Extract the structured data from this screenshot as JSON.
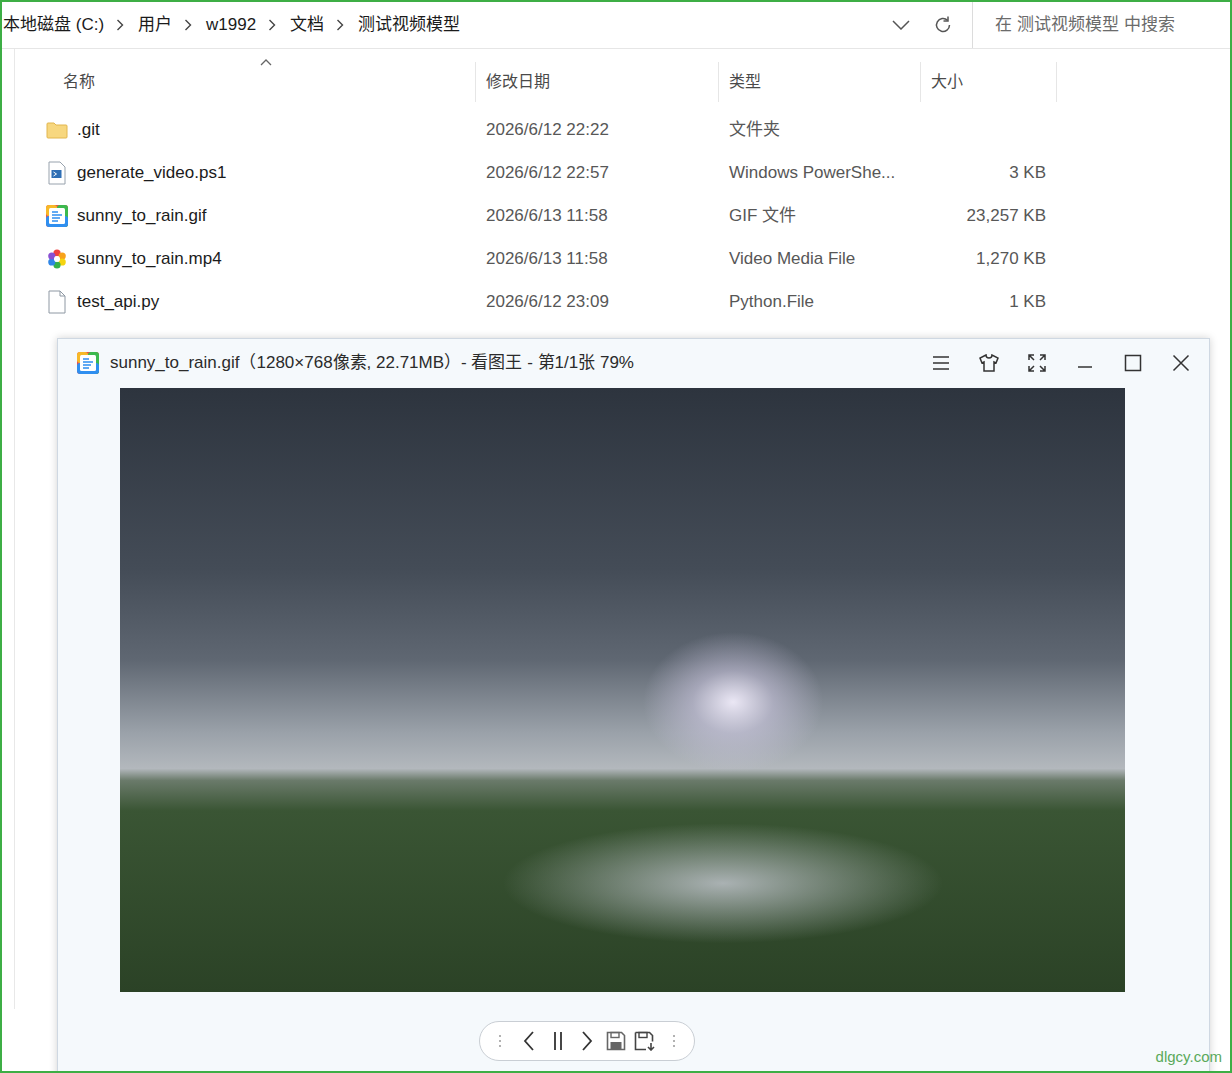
{
  "address_bar": {
    "crumbs": [
      "本地磁盘 (C:)",
      "用户",
      "w1992",
      "文档",
      "测试视频模型"
    ]
  },
  "search": {
    "placeholder": "在 测试视频模型 中搜索"
  },
  "columns": [
    {
      "label": "名称",
      "sorted": true
    },
    {
      "label": "修改日期",
      "sorted": false
    },
    {
      "label": "类型",
      "sorted": false
    },
    {
      "label": "大小",
      "sorted": false
    }
  ],
  "files": [
    {
      "name": ".git",
      "modified": "2026/6/12 22:22",
      "type": "文件夹",
      "kind": "folder"
    },
    {
      "name": "generate_video.ps1",
      "modified": "2026/6/12 22:57",
      "type": "Windows PowerShe...",
      "size": "3 KB",
      "kind": "script"
    },
    {
      "name": "sunny_to_rain.gif",
      "modified": "2026/6/13 11:58",
      "type": "GIF 文件",
      "size": "23,257 KB",
      "kind": "image"
    },
    {
      "name": "sunny_to_rain.mp4",
      "modified": "2026/6/13 11:58",
      "type": "Video Media File",
      "size": "1,270 KB",
      "kind": "video"
    },
    {
      "name": "test_api.py",
      "modified": "2026/6/12 23:09",
      "type": "Python.File",
      "size": "1 KB",
      "kind": "plain"
    }
  ],
  "viewer": {
    "title": "sunny_to_rain.gif（1280×768像素, 22.71MB）- 看图王 - 第1/1张 79%",
    "playing": true
  },
  "watermark": "dlgcy.com"
}
